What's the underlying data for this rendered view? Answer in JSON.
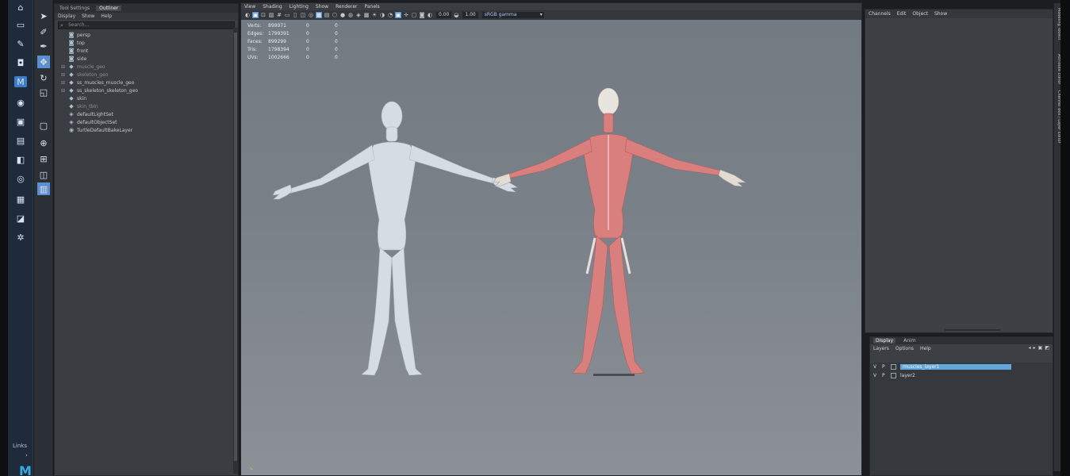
{
  "shelf": {
    "links_label": "Links",
    "logo": "M"
  },
  "outliner": {
    "tabs": [
      "Tool Settings",
      "Outliner"
    ],
    "menu": [
      "Display",
      "Show",
      "Help"
    ],
    "search_placeholder": "Search...",
    "items": [
      {
        "label": "persp",
        "icon": "camera-icon",
        "expandable": false,
        "dim": false
      },
      {
        "label": "top",
        "icon": "camera-icon",
        "expandable": false,
        "dim": false
      },
      {
        "label": "front",
        "icon": "camera-icon",
        "expandable": false,
        "dim": false
      },
      {
        "label": "side",
        "icon": "camera-icon",
        "expandable": false,
        "dim": false
      },
      {
        "label": "muscle_geo",
        "icon": "group-icon",
        "expandable": true,
        "dim": true
      },
      {
        "label": "skeleton_geo",
        "icon": "group-icon",
        "expandable": true,
        "dim": true
      },
      {
        "label": "ss_muscles_muscle_geo",
        "icon": "group-icon",
        "expandable": true,
        "dim": false
      },
      {
        "label": "ss_skeleton_skeleton_geo",
        "icon": "group-icon",
        "expandable": true,
        "dim": false
      },
      {
        "label": "skin",
        "icon": "mesh-icon",
        "expandable": false,
        "dim": false
      },
      {
        "label": "skin_tbln",
        "icon": "mesh-icon",
        "expandable": false,
        "dim": true
      },
      {
        "label": "defaultLightSet",
        "icon": "set-icon",
        "expandable": false,
        "dim": false
      },
      {
        "label": "defaultObjectSet",
        "icon": "set-icon",
        "expandable": false,
        "dim": false
      },
      {
        "label": "TurtleDefaultBakeLayer",
        "icon": "bake-layer-icon",
        "expandable": false,
        "dim": false
      }
    ]
  },
  "viewport": {
    "menu": [
      "View",
      "Shading",
      "Lighting",
      "Show",
      "Renderer",
      "Panels"
    ],
    "exposure": "0.00",
    "gamma": "1.00",
    "color_space": "sRGB gamma",
    "hud": [
      {
        "label": "Verts:",
        "value": "899971",
        "c1": "0",
        "c2": "0"
      },
      {
        "label": "Edges:",
        "value": "1799391",
        "c1": "0",
        "c2": "0"
      },
      {
        "label": "Faces:",
        "value": "899299",
        "c1": "0",
        "c2": "0"
      },
      {
        "label": "Tris:",
        "value": "1798394",
        "c1": "0",
        "c2": "0"
      },
      {
        "label": "UVs:",
        "value": "1002666",
        "c1": "0",
        "c2": "0"
      }
    ]
  },
  "channel_box": {
    "menu": [
      "Channels",
      "Edit",
      "Object",
      "Show"
    ]
  },
  "right_tabs": [
    "Modeling Toolkit",
    "Attribute Editor",
    "Channel Box / Layer Editor"
  ],
  "layer_editor": {
    "tabs": [
      "Display",
      "Anim"
    ],
    "menu": [
      "Layers",
      "Options",
      "Help"
    ],
    "layers": [
      {
        "v": "V",
        "p": "P",
        "name": "muscles_layer1",
        "selected": true
      },
      {
        "v": "V",
        "p": "P",
        "name": "layer2",
        "selected": false
      }
    ]
  },
  "colors": {
    "skin_model": "#d6dce4",
    "muscle_model": "#d97f7d",
    "selection": "#64a6d8",
    "shelf_bg": "#1f2b3b"
  }
}
